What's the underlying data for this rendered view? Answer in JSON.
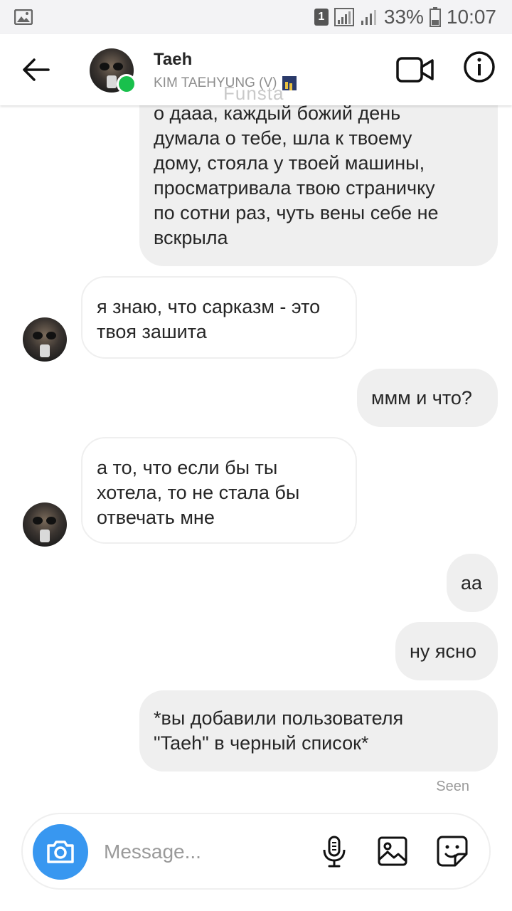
{
  "status_bar": {
    "sim": "1",
    "battery": "33%",
    "time": "10:07"
  },
  "header": {
    "name": "Taeh",
    "subtitle": "KIM TAEHYUNG (V)",
    "watermark": "Funsta"
  },
  "messages": [
    {
      "side": "out",
      "text": "о дааа, каждый божий день\nдумала о тебе, шла к твоему\nдому, стояла у твоей машины,\nпросматривала твою страничку\nпо сотни раз, чуть вены себе не\nвскрыла"
    },
    {
      "side": "in",
      "text": "я знаю, что сарказм - это\nтвоя зашита"
    },
    {
      "side": "out",
      "text": "ммм и что?"
    },
    {
      "side": "in",
      "text": "а то, что если бы ты\nхотела, то не стала бы\nотвечать мне"
    },
    {
      "side": "out",
      "text": "аа"
    },
    {
      "side": "out",
      "text": "ну ясно"
    },
    {
      "side": "out",
      "text": "*вы добавили пользователя\n\"Taeh\" в черный список*"
    }
  ],
  "seen_label": "Seen",
  "composer": {
    "placeholder": "Message..."
  },
  "colors": {
    "accent": "#3897f0",
    "online": "#19c04c",
    "bubble": "#efefef"
  }
}
